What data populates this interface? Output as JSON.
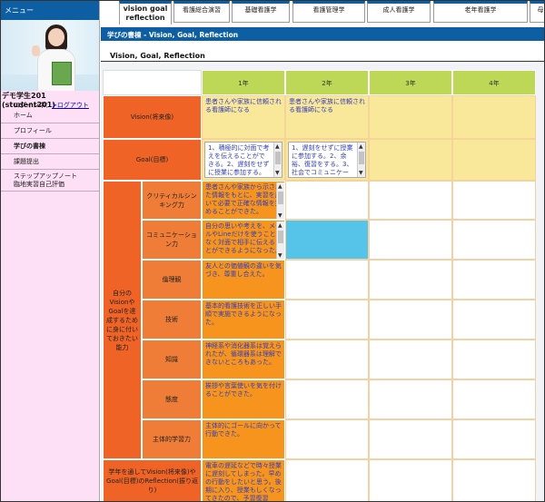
{
  "sidebar": {
    "header": "メニュー",
    "user_name": "デモ学生201 (student201)",
    "login_label": "ログイン中：",
    "logout_link": ">ログアウト",
    "items": [
      {
        "label": "ホーム"
      },
      {
        "label": "プロフィール"
      },
      {
        "label": "学びの書棟"
      },
      {
        "label": "課題提出"
      },
      {
        "label": "ステップアップノート"
      },
      {
        "label": "臨地実習自己評価"
      }
    ]
  },
  "tabs": [
    {
      "line1": "vision goal",
      "line2": "reflection"
    },
    {
      "line1": "看護総合演習"
    },
    {
      "line1": "基礎看護学"
    },
    {
      "line1": "看護管理学"
    },
    {
      "line1": "成人看護学"
    },
    {
      "line1": "老年看護学"
    },
    {
      "line1": "母"
    }
  ],
  "section_title": "学びの書棟 - Vision, Goal, Reflection",
  "sub_title": "Vision, Goal, Reflection",
  "years": [
    "1年",
    "2年",
    "3年",
    "4年"
  ],
  "rows": {
    "vision": {
      "label": "Vision(将来像)",
      "y1": "患者さんや家族に信頼される看護師になる",
      "y2": "患者さんや家族に信頼される看護師になる"
    },
    "goal": {
      "label": "Goal(目標)",
      "y1": "1、積極的に対面で考えを伝えることができる。2、遅刻をせずに授業に参加する。",
      "y2": "1、遅刻をせずに授業に参加する。2、余裕、復習をする。3、社会でコミュニケーション能力を養う。"
    },
    "ability_group": "自分のVisionやGoalを達成するために身に付いておきたい能力",
    "critical": {
      "label": "クリティカルシンキング力",
      "y1": "患者さんや家族から示された情報をもとに、実習を用いて必要で正確な情報を集めることができた。"
    },
    "communication": {
      "label": "コミュニケーション力",
      "y1": "自分の思いや考えを、メールやLineだけを使うことなく対面で相手に伝えることができるようになった。"
    },
    "ethics": {
      "label": "倫理観",
      "y1": "友人との価値観の違いを気づき、尊重し合えた。"
    },
    "skill": {
      "label": "技術",
      "y1": "基本的看護技術を正しい手順で実施できるようになった。"
    },
    "knowledge": {
      "label": "知識",
      "y1": "神経系や消化器系は覚えられたが、循環器系は理解できないところもあった。"
    },
    "attitude": {
      "label": "態度",
      "y1": "挨拶や言葉使いを気を付けることができた。"
    },
    "independent": {
      "label": "主体的学習力",
      "y1": "主体的にゴールに向かって行動できた。"
    },
    "reflection": {
      "label": "学年を通してVision(将来像)やGoal(目標)のReflection(振り返り)",
      "y1": "電車の遅延などで時々授業に遅刻してしまった。早めの行動をしたいと思う。後期に入り、授業もしくなってきたので、予習復習"
    }
  }
}
